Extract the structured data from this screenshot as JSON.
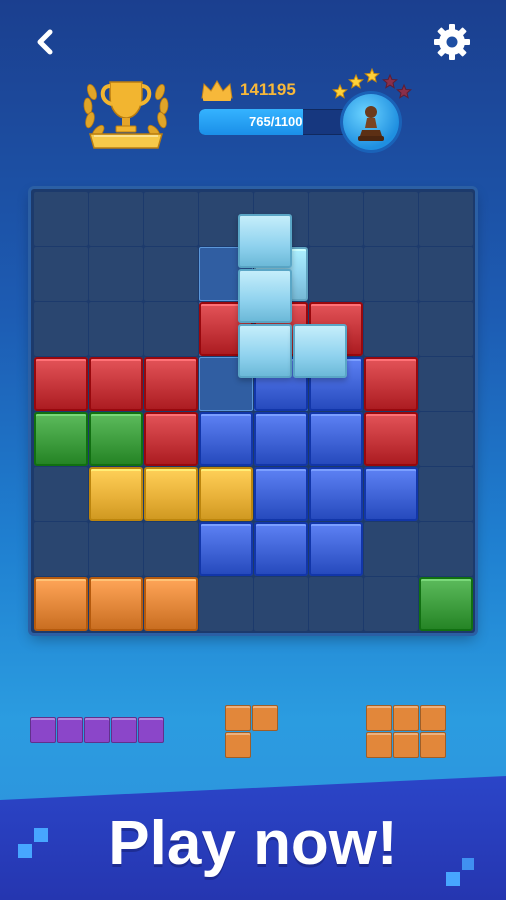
{
  "header": {
    "back_icon": "chevron-left-icon",
    "settings_icon": "gear-icon"
  },
  "trophy": {
    "icon": "trophy-laurel-icon"
  },
  "score": {
    "icon": "crown-icon",
    "value": "141195",
    "color": "#f7b83a"
  },
  "progress": {
    "text": "765/1100",
    "current": 765,
    "max": 1100
  },
  "rank": {
    "icon": "chess-pawn-icon",
    "stars_filled": 3,
    "stars_total": 5
  },
  "board": {
    "size": 8,
    "colors": {
      "R": "#c5353a",
      "G": "#3e9d3e",
      "Y": "#e9b23a",
      "B": "#3f63d6",
      "O": "#e2873a",
      "L": "#8fd2ee"
    },
    "rows": [
      "........",
      "....L...",
      "...RRR..",
      "RRR.BBR.",
      "GGRBBBR.",
      ".YYYBBB.",
      "...BBB..",
      "OOO....G"
    ]
  },
  "tray": {
    "pieces": [
      {
        "name": "purple-line-piece",
        "color": "#8b46c9",
        "shape": "1x5"
      },
      {
        "name": "orange-l-piece",
        "color": "#e2873a",
        "shape": "l3"
      },
      {
        "name": "orange-block-piece",
        "color": "#e2873a",
        "shape": "2x3"
      }
    ]
  },
  "cta": {
    "label": "Play now!"
  }
}
